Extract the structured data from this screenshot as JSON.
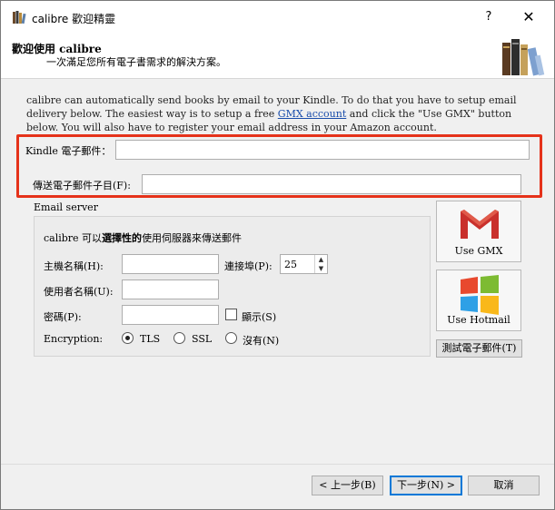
{
  "window": {
    "title": "calibre 歡迎精靈",
    "help_label": "?",
    "close_label": "✕"
  },
  "header": {
    "title": "歡迎使用 calibre",
    "subtitle": "一次滿足您所有電子書需求的解決方案。"
  },
  "description": {
    "text_part1": "calibre can automatically send books by email to your Kindle. To do that you have to setup email delivery below. The easiest way is to setup a free ",
    "link": "GMX account",
    "text_part2": " and click the \"Use GMX\" button below. You will also have to register your email address in your Amazon account."
  },
  "kindle_email": {
    "label": "Kindle 電子郵件：",
    "value": ""
  },
  "send_subject": {
    "label": "傳送電子郵件子目(F):",
    "value": ""
  },
  "email_server": {
    "group_label": "Email server",
    "intro_prefix": "calibre 可以",
    "intro_bold": "選擇性的",
    "intro_suffix": "使用伺服器來傳送郵件",
    "hostname_label": "主機名稱(H):",
    "hostname_value": "",
    "port_label": "連接埠(P):",
    "port_value": "25",
    "username_label": "使用者名稱(U):",
    "username_value": "",
    "password_label": "密碼(P):",
    "password_value": "",
    "show_label": "顯示(S)",
    "encryption_label": "Encryption:",
    "encryption_options": [
      "TLS",
      "SSL",
      "沒有(N)"
    ],
    "encryption_selected": "TLS"
  },
  "side_buttons": {
    "use_gmx": "Use GMX",
    "use_hotmail": "Use Hotmail",
    "test_email": "測試電子郵件(T)"
  },
  "footer": {
    "back": "< 上一步(B)",
    "next": "下一步(N) >",
    "cancel": "取消"
  },
  "colors": {
    "highlight": "#e5321a",
    "link": "#1a4dab",
    "gmx_red": "#c9302c"
  }
}
